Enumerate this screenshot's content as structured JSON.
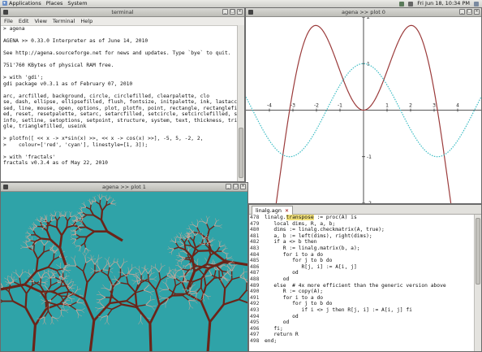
{
  "panel": {
    "menus": [
      "Applications",
      "Places",
      "System"
    ],
    "clock": "Fri Jun 18, 10:34 PM"
  },
  "terminal": {
    "title": "terminal",
    "menu": [
      "File",
      "Edit",
      "View",
      "Terminal",
      "Help"
    ],
    "lines": [
      "> agena",
      "",
      "AGENA >> 0.33.0 Interpreter as of June 14, 2010",
      "",
      "See http://agena.sourceforge.net for news and updates. Type `bye` to quit.",
      "",
      "751'760 KBytes of physical RAM free.",
      "",
      "> with 'gdi';",
      "gdi package v0.3.1 as of February 07, 2010",
      "",
      "arc, arcfilled, background, circle, circlefilled, clearpalette, clo",
      "se, dash, ellipse, ellipsefilled, flush, fontsize, initpalette, ink, lastacces",
      "sed, line, mouse, open, options, plot, plotfn, point, rectangle, rectanglefill",
      "ed, reset, resetpalette, setarc, setarcfilled, setcircle, setcirclefilled, set",
      "info, setline, setoptions, setpoint, structure, system, text, thickness, trian",
      "gle, trianglefilled, useink",
      "",
      "> plotfn([ << x -> x*sin(x) >>, << x -> cos(x) >>], -5, 5, -2, 2,",
      ">    colour=['red', 'cyan'], linestyle=[1, 3]);",
      "",
      "> with 'fractals'",
      "fractals v0.3.4 as of May 22, 2010"
    ]
  },
  "plot0": {
    "title": "agena >> plot 0",
    "xticks": [
      "-4",
      "-3",
      "-2",
      "-1",
      "1",
      "2",
      "3",
      "4"
    ],
    "yticks": [
      "2",
      "1",
      "-1",
      "-2"
    ]
  },
  "plot1": {
    "title": "agena >> plot 1"
  },
  "editor": {
    "tab": "linalg.agn",
    "highlight": "transpose",
    "lines": [
      {
        "n": "478",
        "pre": "linalg.",
        "hl": "transpose",
        "post": " := proc(A) is"
      },
      {
        "n": "479",
        "pre": "   local dims, R, a, b;",
        "hl": "",
        "post": ""
      },
      {
        "n": "480",
        "pre": "   dims := linalg.checkmatrix(A, true);",
        "hl": "",
        "post": ""
      },
      {
        "n": "481",
        "pre": "   a, b := left(dims), right(dims);",
        "hl": "",
        "post": ""
      },
      {
        "n": "482",
        "pre": "   if a <> b then",
        "hl": "",
        "post": ""
      },
      {
        "n": "483",
        "pre": "      R := linalg.matrix(b, a);",
        "hl": "",
        "post": ""
      },
      {
        "n": "484",
        "pre": "      for i to a do",
        "hl": "",
        "post": ""
      },
      {
        "n": "485",
        "pre": "         for j to b do",
        "hl": "",
        "post": ""
      },
      {
        "n": "486",
        "pre": "            R[j, i] := A[i, j]",
        "hl": "",
        "post": ""
      },
      {
        "n": "487",
        "pre": "         od",
        "hl": "",
        "post": ""
      },
      {
        "n": "488",
        "pre": "      od",
        "hl": "",
        "post": ""
      },
      {
        "n": "489",
        "pre": "   else  # 4x more efficient than the generic version above",
        "hl": "",
        "post": ""
      },
      {
        "n": "490",
        "pre": "      R := copy(A);",
        "hl": "",
        "post": ""
      },
      {
        "n": "491",
        "pre": "      for i to a do",
        "hl": "",
        "post": ""
      },
      {
        "n": "492",
        "pre": "         for j to b do",
        "hl": "",
        "post": ""
      },
      {
        "n": "493",
        "pre": "            if i <> j then R[j, i] := A[i, j] fi",
        "hl": "",
        "post": ""
      },
      {
        "n": "494",
        "pre": "         od",
        "hl": "",
        "post": ""
      },
      {
        "n": "495",
        "pre": "      od",
        "hl": "",
        "post": ""
      },
      {
        "n": "496",
        "pre": "   fi;",
        "hl": "",
        "post": ""
      },
      {
        "n": "497",
        "pre": "   return R",
        "hl": "",
        "post": ""
      },
      {
        "n": "498",
        "pre": "end;",
        "hl": "",
        "post": ""
      }
    ]
  },
  "chart_data": {
    "type": "line",
    "series": [
      {
        "color": "#9b3b3b",
        "style": "solid"
      },
      {
        "color": "#3bbcc4",
        "style": "dotted"
      }
    ],
    "xlim": [
      -5,
      5
    ],
    "ylim": [
      -2,
      2
    ],
    "xticks": [
      -4,
      -3,
      -2,
      -1,
      1,
      2,
      3,
      4
    ],
    "yticks": [
      2,
      1,
      -1,
      -2
    ],
    "grid": false
  },
  "colors": {
    "curve1": "#9b3b3b",
    "curve2": "#3bbcc4",
    "fractal_bg": "#2fa3a8",
    "fractal_fill": "#6b2418",
    "highlight": "#f3e27a"
  }
}
